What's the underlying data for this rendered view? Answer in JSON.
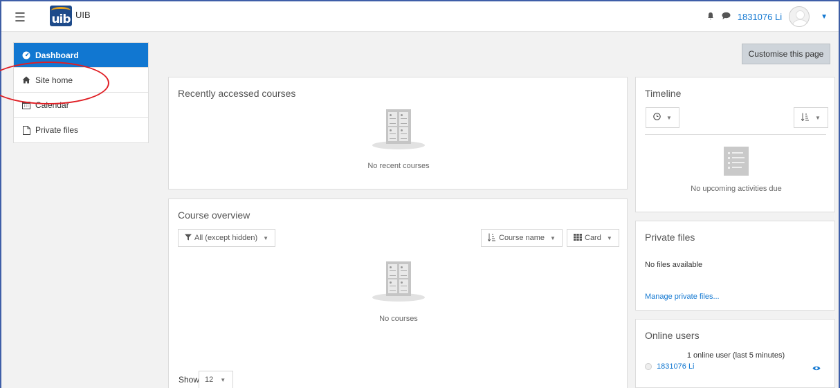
{
  "navbar": {
    "logo_text": "uib",
    "site_name": "UIB",
    "username": "1831076 Li"
  },
  "drawer": {
    "items": [
      {
        "label": "Dashboard",
        "icon": "dashboard-icon",
        "active": true
      },
      {
        "label": "Site home",
        "icon": "home-icon",
        "active": false
      },
      {
        "label": "Calendar",
        "icon": "calendar-icon",
        "active": false
      },
      {
        "label": "Private files",
        "icon": "file-icon",
        "active": false
      }
    ]
  },
  "page": {
    "customise_label": "Customise this page"
  },
  "recent_courses": {
    "title": "Recently accessed courses",
    "empty_text": "No recent courses"
  },
  "course_overview": {
    "title": "Course overview",
    "filter_label": "All (except hidden)",
    "sort_label": "Course name",
    "view_label": "Card",
    "empty_text": "No courses",
    "show_label": "Show",
    "show_value": "12"
  },
  "timeline": {
    "title": "Timeline",
    "empty_text": "No upcoming activities due"
  },
  "private_files": {
    "title": "Private files",
    "empty_text": "No files available",
    "manage_link": "Manage private files..."
  },
  "online_users": {
    "title": "Online users",
    "summary": "1 online user (last 5 minutes)",
    "user": "1831076 Li"
  },
  "colors": {
    "accent": "#1177d1",
    "annotation": "#e01e24",
    "frame": "#3f5fa8"
  }
}
